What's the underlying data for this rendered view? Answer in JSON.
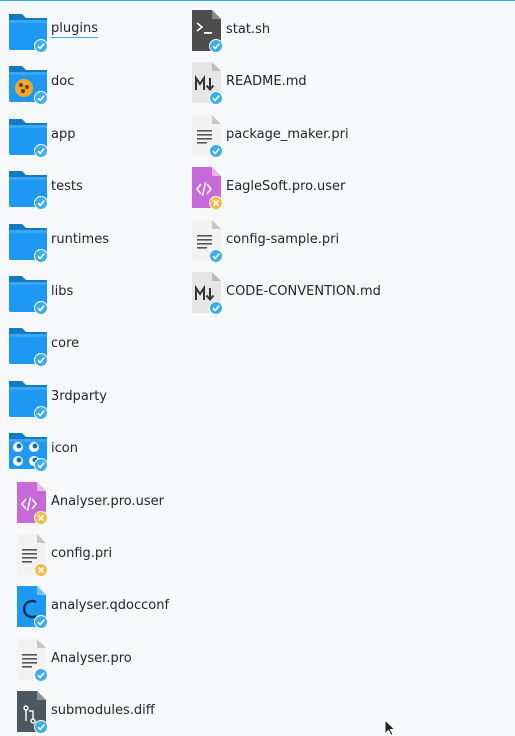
{
  "colors": {
    "accent": "#3daee9",
    "folder": "#1d99f3",
    "badge_ok": "#3daee9",
    "badge_warn": "#f6b94b",
    "shell_bg": "#4d4d4d",
    "qml_bg": "#c56ad7"
  },
  "files": [
    {
      "label": "plugins",
      "icon": "folder-icon",
      "badge": "ok",
      "selected": true
    },
    {
      "label": "doc",
      "icon": "folder-doc-icon",
      "badge": "ok"
    },
    {
      "label": "app",
      "icon": "folder-icon",
      "badge": "ok"
    },
    {
      "label": "tests",
      "icon": "folder-icon",
      "badge": "ok"
    },
    {
      "label": "runtimes",
      "icon": "folder-icon",
      "badge": "ok"
    },
    {
      "label": "libs",
      "icon": "folder-icon",
      "badge": "ok"
    },
    {
      "label": "core",
      "icon": "folder-icon",
      "badge": "ok"
    },
    {
      "label": "3rdparty",
      "icon": "folder-icon",
      "badge": "ok"
    },
    {
      "label": "icon",
      "icon": "folder-images-icon",
      "badge": "ok"
    },
    {
      "label": "Analyser.pro.user",
      "icon": "code-file-icon",
      "badge": "warn"
    },
    {
      "label": "config.pri",
      "icon": "text-file-icon",
      "badge": "warn"
    },
    {
      "label": "analyser.qdocconf",
      "icon": "qdoc-file-icon",
      "badge": "ok"
    },
    {
      "label": "Analyser.pro",
      "icon": "text-file-icon",
      "badge": "ok"
    },
    {
      "label": "submodules.diff",
      "icon": "diff-file-icon",
      "badge": "ok"
    },
    {
      "label": "stat.sh",
      "icon": "shell-script-icon",
      "badge": "ok"
    },
    {
      "label": "README.md",
      "icon": "markdown-file-icon",
      "badge": "ok"
    },
    {
      "label": "package_maker.pri",
      "icon": "text-file-icon",
      "badge": "ok"
    },
    {
      "label": "EagleSoft.pro.user",
      "icon": "code-file-icon",
      "badge": "warn"
    },
    {
      "label": "config-sample.pri",
      "icon": "text-file-icon",
      "badge": "ok"
    },
    {
      "label": "CODE-CONVENTION.md",
      "icon": "markdown-file-icon",
      "badge": "ok"
    }
  ]
}
